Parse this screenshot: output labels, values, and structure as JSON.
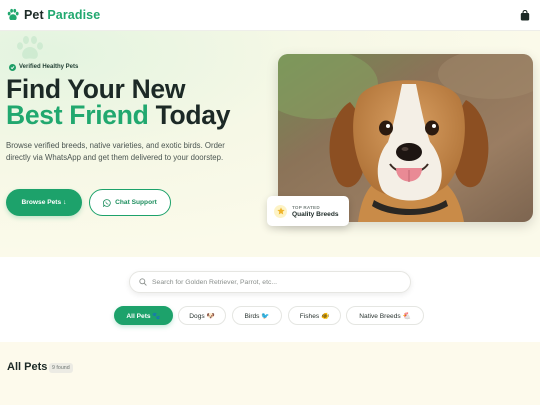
{
  "header": {
    "brand_part1": "Pet",
    "brand_part2": "Paradise",
    "logo_icon": "paw-icon",
    "cart_icon": "shopping-bag-icon"
  },
  "hero": {
    "badge": "Verified Healthy Pets",
    "title_line1": "Find Your New",
    "title_highlight": "Best Friend",
    "title_rest": "Today",
    "description": "Browse verified breeds, native varieties, and exotic birds. Order directly via WhatsApp and get them delivered to your doorstep.",
    "primary_button": "Browse Pets",
    "primary_icon": "↓",
    "secondary_button": "Chat Support",
    "secondary_icon": "whatsapp-icon",
    "rating_small": "TOP RATED",
    "rating_big": "Quality Breeds",
    "photo_icon": "beagle-dog-photo"
  },
  "search": {
    "placeholder": "Search for Golden Retriever, Parrot, etc..."
  },
  "filters": [
    {
      "label": "All Pets 🐾",
      "active": true
    },
    {
      "label": "Dogs 🐶",
      "active": false
    },
    {
      "label": "Birds 🐦",
      "active": false
    },
    {
      "label": "Fishes 🐠",
      "active": false
    },
    {
      "label": "Native Breeds 🐔",
      "active": false
    }
  ],
  "listing": {
    "title": "All Pets",
    "count": "9 found"
  },
  "colors": {
    "accent": "#1da26b",
    "brand_green": "#21a86f",
    "text_dark": "#1c2926",
    "hero_bg": "#fbfaea"
  }
}
